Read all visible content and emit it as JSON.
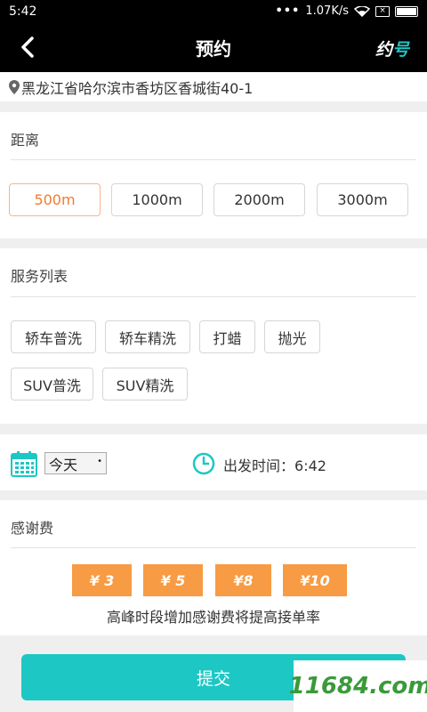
{
  "status_bar": {
    "time": "5:42",
    "dots": "•••",
    "speed": "1.07K/s",
    "sim_label": "×"
  },
  "app_bar": {
    "title": "预约",
    "logo_main": "约",
    "logo_accent": "号"
  },
  "address": "黑龙江省哈尔滨市香坊区香城街40-1",
  "distance": {
    "title": "距离",
    "options": [
      "500m",
      "1000m",
      "2000m",
      "3000m"
    ],
    "selected": "500m"
  },
  "services": {
    "title": "服务列表",
    "items": [
      "轿车普洗",
      "轿车精洗",
      "打蜡",
      "抛光",
      "SUV普洗",
      "SUV精洗"
    ]
  },
  "schedule": {
    "day": "今天",
    "depart_label": "出发时间：",
    "depart_time": "6:42"
  },
  "tip": {
    "title": "感谢费",
    "options": [
      "¥ 3",
      "¥ 5",
      "¥8",
      "¥10"
    ],
    "note": "高峰时段增加感谢费将提高接单率"
  },
  "submit_label": "提交",
  "watermark": "11684.com",
  "colors": {
    "accent": "#1dc7c4",
    "orange": "#f79b44",
    "selected_text": "#f07c2f"
  }
}
